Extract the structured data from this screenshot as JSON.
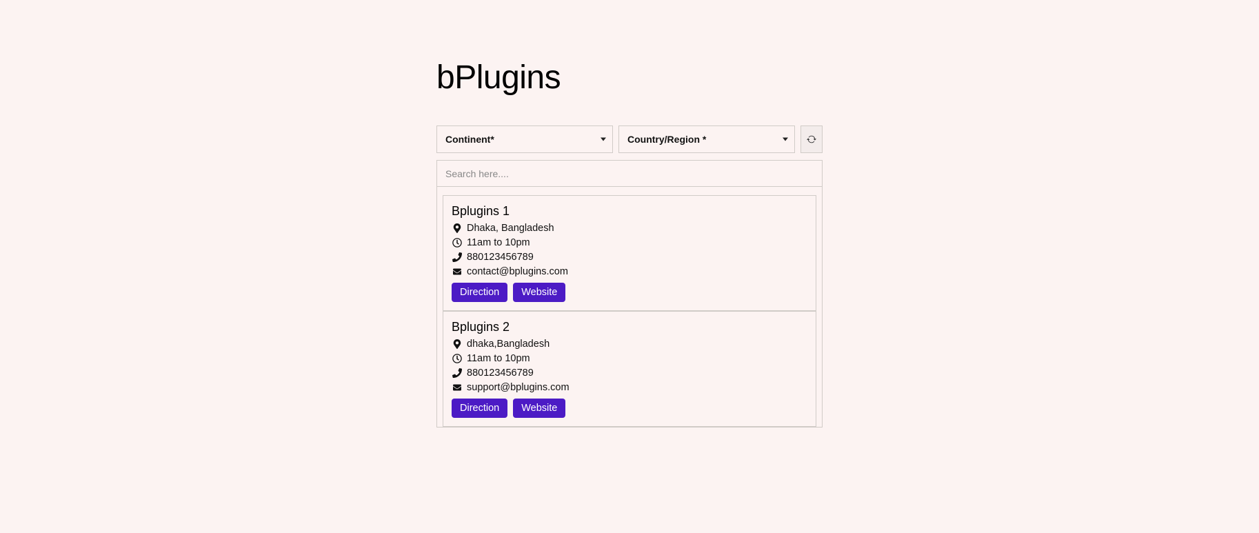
{
  "page": {
    "title": "bPlugins"
  },
  "filters": {
    "continent_label": "Continent*",
    "country_label": "Country/Region *",
    "search_placeholder": "Search here...."
  },
  "buttons": {
    "direction": "Direction",
    "website": "Website"
  },
  "cards": [
    {
      "name": "Bplugins 1",
      "address": "Dhaka, Bangladesh",
      "hours": "11am to 10pm",
      "phone": "880123456789",
      "email": "contact@bplugins.com"
    },
    {
      "name": "Bplugins 2",
      "address": "dhaka,Bangladesh",
      "hours": "11am to 10pm",
      "phone": "880123456789",
      "email": "support@bplugins.com"
    }
  ]
}
